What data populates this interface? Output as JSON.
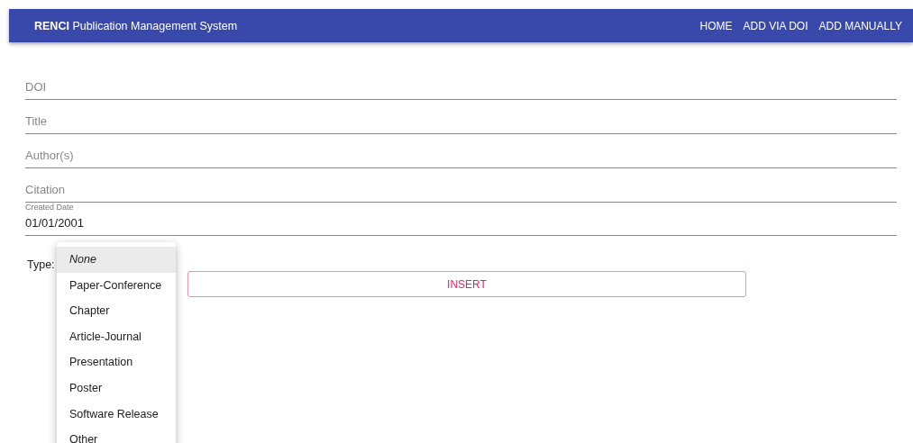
{
  "app_bar": {
    "title": "**RENCI** Publication Management System",
    "nav": [
      "HOME",
      "ADD VIA DOI",
      "ADD MANUALLY"
    ]
  },
  "fields": [
    {
      "kind": "empty",
      "label": "DOI"
    },
    {
      "kind": "empty",
      "label": "Title"
    },
    {
      "kind": "empty",
      "label": "Author(s)"
    },
    {
      "kind": "empty",
      "label": "Citation"
    },
    {
      "kind": "filled",
      "label": "Created Date",
      "value": "01/01/2001"
    }
  ],
  "type_select": {
    "label": "Type:",
    "options": [
      {
        "kind": "none",
        "label": "None",
        "selected": true
      },
      {
        "kind": "type",
        "label": "Paper-Conference",
        "selected": false
      },
      {
        "kind": "type",
        "label": "Chapter",
        "selected": false
      },
      {
        "kind": "type",
        "label": "Article-Journal",
        "selected": false
      },
      {
        "kind": "type",
        "label": "Presentation",
        "selected": false
      },
      {
        "kind": "type",
        "label": "Poster",
        "selected": false
      },
      {
        "kind": "type",
        "label": "Software Release",
        "selected": false
      },
      {
        "kind": "type",
        "label": "Other",
        "selected": false
      }
    ]
  },
  "insert_button": "INSERT"
}
